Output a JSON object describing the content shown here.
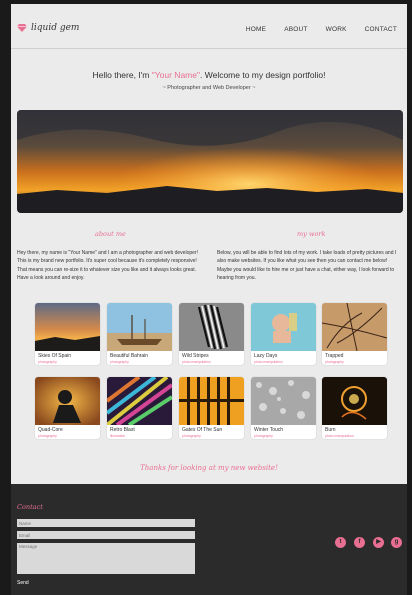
{
  "brand": {
    "logo": "liquid gem"
  },
  "nav": [
    {
      "label": "HOME"
    },
    {
      "label": "ABOUT"
    },
    {
      "label": "WORK"
    },
    {
      "label": "CONTACT"
    }
  ],
  "intro": {
    "hello_pre": "Hello there, I'm ",
    "name": "\"Your Name\"",
    "hello_post": ". Welcome to my design portfolio!",
    "subtitle": "~ Photographer and Web Developer ~"
  },
  "about": {
    "heading": "about me",
    "text": "Hey there, my name is \"Your Name\" and I am a photographer and web developer! This is my brand new portfolio. It's super cool because it's completely responsive! That means you can re-size it to whatever size you like and it always looks great. Have a look around and enjoy."
  },
  "work": {
    "heading": "my work",
    "text": "Below, you will be able to find lots of my work. I take loads of pretty pictures and I also make websites. If you like what you see then you can contact me below! Maybe you would like to hire me or just have a chat, either way, I look forward to hearing from you."
  },
  "portfolio": [
    {
      "title": "Skies Of Spain",
      "category": "photography",
      "thumb": "sunset"
    },
    {
      "title": "Beautiful Bahrain",
      "category": "photography",
      "thumb": "boat"
    },
    {
      "title": "Wild Stripes",
      "category": "photo manipulation",
      "thumb": "zebra"
    },
    {
      "title": "Lazy Days",
      "category": "photo manipulation",
      "thumb": "pool"
    },
    {
      "title": "Trapped",
      "category": "photography",
      "thumb": "branches"
    },
    {
      "title": "Quad-Core",
      "category": "photography",
      "thumb": "rider"
    },
    {
      "title": "Retro Blast",
      "category": "illustration",
      "thumb": "rays"
    },
    {
      "title": "Gates Of The Sun",
      "category": "photography",
      "thumb": "gates"
    },
    {
      "title": "Winter Touch",
      "category": "photography",
      "thumb": "frost"
    },
    {
      "title": "Burn",
      "category": "photo manipulation",
      "thumb": "fire"
    }
  ],
  "thanks": "Thanks for looking at my new website!",
  "contact": {
    "heading": "Contact",
    "name_placeholder": "Name",
    "email_placeholder": "Email",
    "message_placeholder": "Message",
    "send_label": "Send"
  },
  "social": [
    {
      "icon": "twitter-icon",
      "glyph": "t"
    },
    {
      "icon": "facebook-icon",
      "glyph": "f"
    },
    {
      "icon": "youtube-icon",
      "glyph": "▶"
    },
    {
      "icon": "googleplus-icon",
      "glyph": "g"
    }
  ],
  "colors": {
    "accent": "#e86f92",
    "page_bg": "#ebebeb",
    "footer_bg": "#2b2b2b"
  }
}
